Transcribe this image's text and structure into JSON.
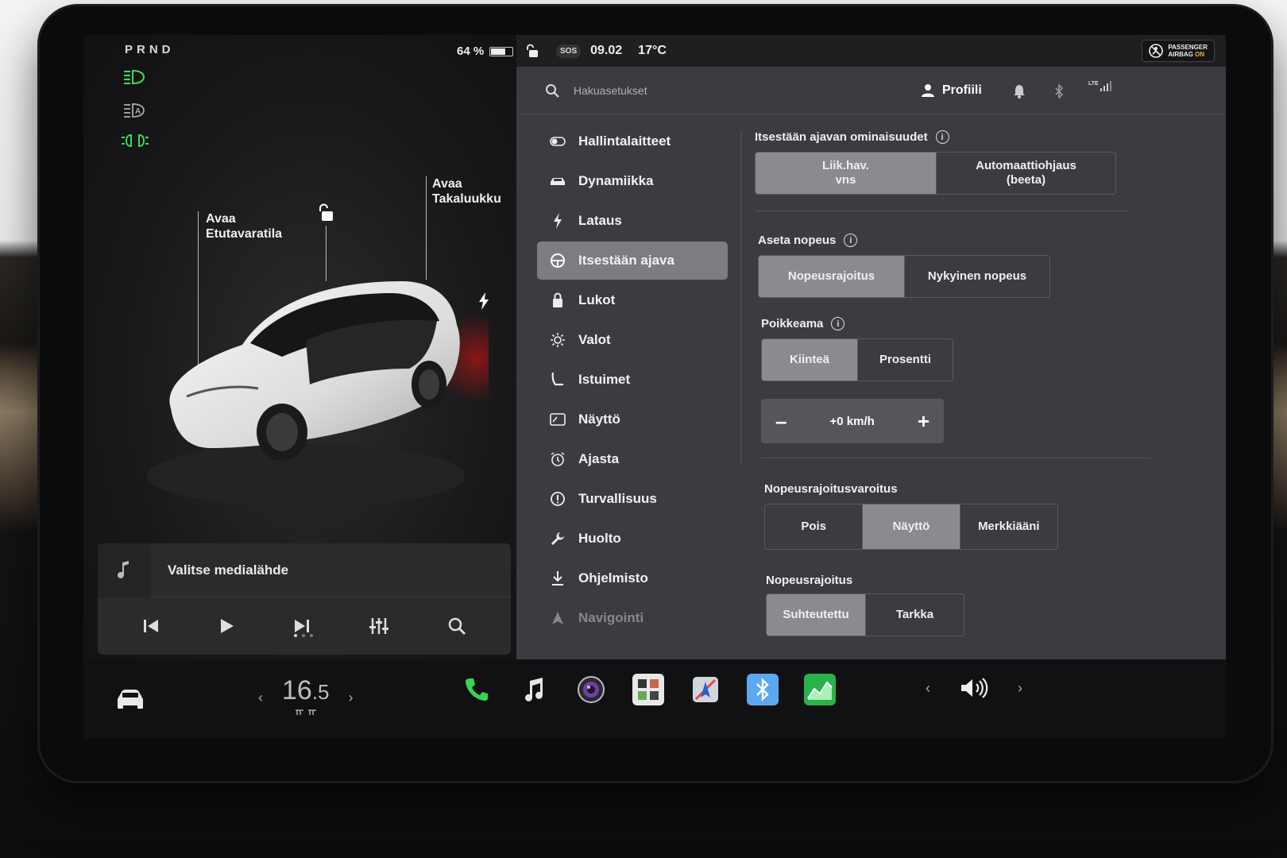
{
  "left": {
    "gear": "PRND",
    "battery": "64 %",
    "battery_level": 0.64,
    "front_trunk": {
      "line1": "Avaa",
      "line2": "Etutavaratila"
    },
    "rear_trunk": {
      "line1": "Avaa",
      "line2": "Takaluukku"
    },
    "media": {
      "title": "Valitse medialähde"
    }
  },
  "status": {
    "sos": "SOS",
    "time": "09.02",
    "temp": "17°C",
    "airbag_line1": "PASSENGER",
    "airbag_line2": "AIRBAG",
    "airbag_state": "ON"
  },
  "topbar": {
    "search_placeholder": "Hakuasetukset",
    "profile": "Profiili",
    "network": "LTE"
  },
  "menu": {
    "items": [
      {
        "label": "Hallintalaitteet",
        "icon": "toggle-icon"
      },
      {
        "label": "Dynamiikka",
        "icon": "car-icon"
      },
      {
        "label": "Lataus",
        "icon": "bolt-icon"
      },
      {
        "label": "Itsestään ajava",
        "icon": "steering-wheel-icon"
      },
      {
        "label": "Lukot",
        "icon": "lock-icon"
      },
      {
        "label": "Valot",
        "icon": "sun-icon"
      },
      {
        "label": "Istuimet",
        "icon": "seat-icon"
      },
      {
        "label": "Näyttö",
        "icon": "display-icon"
      },
      {
        "label": "Ajasta",
        "icon": "alarm-clock-icon"
      },
      {
        "label": "Turvallisuus",
        "icon": "alert-icon"
      },
      {
        "label": "Huolto",
        "icon": "wrench-icon"
      },
      {
        "label": "Ohjelmisto",
        "icon": "download-icon"
      },
      {
        "label": "Navigointi",
        "icon": "navigation-icon"
      }
    ],
    "active_index": 3
  },
  "settings": {
    "autopilot": {
      "title": "Itsestään ajavan ominaisuudet",
      "options": [
        {
          "line1": "Liik.hav.",
          "line2": "vns"
        },
        {
          "line1": "Automaattiohjaus",
          "line2": "(beeta)"
        }
      ]
    },
    "set_speed": {
      "title": "Aseta nopeus",
      "options": [
        "Nopeusrajoitus",
        "Nykyinen nopeus"
      ]
    },
    "offset": {
      "title": "Poikkeama",
      "options": [
        "Kiinteä",
        "Prosentti"
      ],
      "value": "+0 km/h",
      "minus": "–",
      "plus": "+"
    },
    "speed_warning": {
      "title": "Nopeusrajoitusvaroitus",
      "options": [
        "Pois",
        "Näyttö",
        "Merkkiääni"
      ]
    },
    "speed_limit": {
      "title": "Nopeusrajoitus",
      "options": [
        "Suhteutettu",
        "Tarkka"
      ]
    }
  },
  "taskbar": {
    "temp_int": "16",
    "temp_dec": ".5",
    "left_chevron": "‹",
    "right_chevron": "›"
  }
}
